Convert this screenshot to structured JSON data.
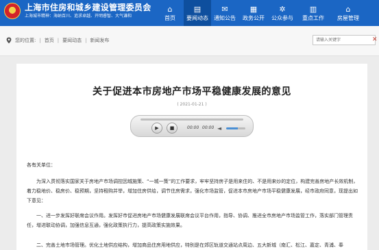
{
  "header": {
    "site_title": "上海市住房和城乡建设管理委员会",
    "motto": "上海城市精神：海纳百川、追求卓越、开明睿智、大气谦和",
    "brand_color": "#1b66c4",
    "nav": [
      {
        "label": "首页",
        "icon": "home-icon"
      },
      {
        "label": "要闻动态",
        "icon": "news-icon",
        "active": true
      },
      {
        "label": "通知公告",
        "icon": "mail-icon"
      },
      {
        "label": "政务公开",
        "icon": "grid-icon"
      },
      {
        "label": "公众参与",
        "icon": "gear-icon"
      },
      {
        "label": "重点工作",
        "icon": "building-icon"
      },
      {
        "label": "房屋管理",
        "icon": "house-icon"
      }
    ]
  },
  "breadcrumb": {
    "prefix": "您的位置:",
    "items": [
      "首页",
      "要闻动态",
      "新闻发布"
    ]
  },
  "search": {
    "placeholder": "请输入关键字"
  },
  "article": {
    "title": "关于促进本市房地产市场平稳健康发展的意见",
    "date": "( 2021-01-21 )",
    "player": {
      "current": "00:00",
      "total": "00:00"
    },
    "greeting": "各有关单位：",
    "paragraphs": [
      "为深入贯彻落实国家关于房地产市场调控因城施策、“一城一策”的工作要求，牢牢坚持房子是用来住的、不是用来炒的定位，构建完善房地产长效机制，着力稳地价、稳房价、稳预期，坚持租购并举，增加住房供给，调节住房需求，强化市场监管，促进本市房地产市场平稳健康发展，经市政府同意，现提出如下意见：",
      "一、进一步发挥好联席会议作用。发挥好市促进房地产市场健康发展联席会议平台作用，指导、协调、推进全市房地产市场监管工作，落实部门管理责任，增进联动协调，加强信息互通，强化政策执行力，提高政策实施效果。",
      "二、完善土地市场管理。优化土地供应结构，增加商品住房用地供应，特别是在郊区轨道交通站点周边、五大新城（南汇、松江、嘉定、青浦、奉"
    ]
  }
}
